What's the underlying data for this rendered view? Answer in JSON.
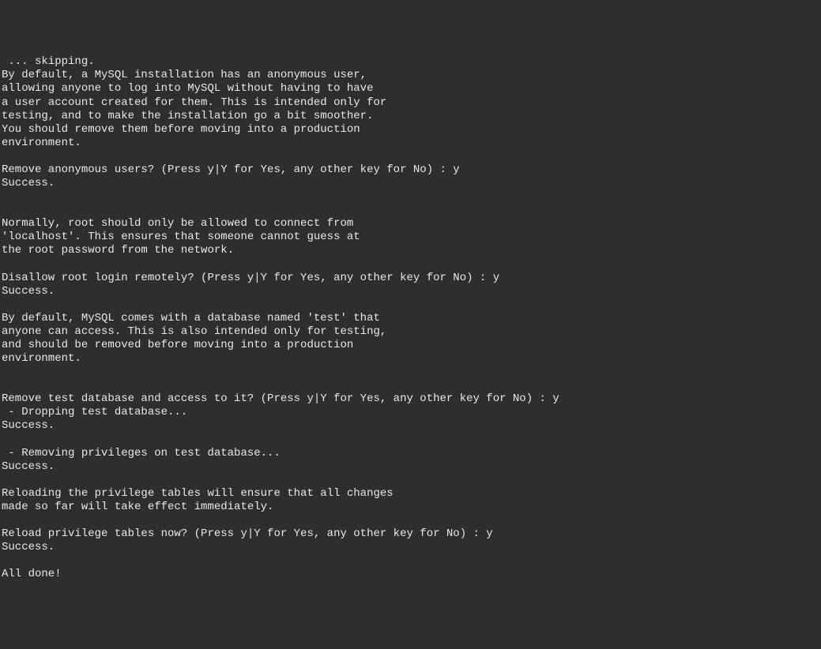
{
  "terminal": {
    "lines": [
      " ... skipping.",
      "By default, a MySQL installation has an anonymous user,",
      "allowing anyone to log into MySQL without having to have",
      "a user account created for them. This is intended only for",
      "testing, and to make the installation go a bit smoother.",
      "You should remove them before moving into a production",
      "environment.",
      "",
      "Remove anonymous users? (Press y|Y for Yes, any other key for No) : y",
      "Success.",
      "",
      "",
      "Normally, root should only be allowed to connect from",
      "'localhost'. This ensures that someone cannot guess at",
      "the root password from the network.",
      "",
      "Disallow root login remotely? (Press y|Y for Yes, any other key for No) : y",
      "Success.",
      "",
      "By default, MySQL comes with a database named 'test' that",
      "anyone can access. This is also intended only for testing,",
      "and should be removed before moving into a production",
      "environment.",
      "",
      "",
      "Remove test database and access to it? (Press y|Y for Yes, any other key for No) : y",
      " - Dropping test database...",
      "Success.",
      "",
      " - Removing privileges on test database...",
      "Success.",
      "",
      "Reloading the privilege tables will ensure that all changes",
      "made so far will take effect immediately.",
      "",
      "Reload privilege tables now? (Press y|Y for Yes, any other key for No) : y",
      "Success.",
      "",
      "All done!"
    ]
  }
}
